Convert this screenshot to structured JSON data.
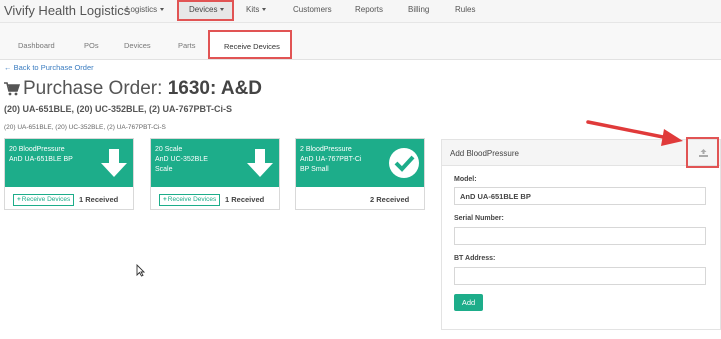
{
  "app": {
    "brand": "Vivify Health Logistics"
  },
  "nav": {
    "items": [
      {
        "label": "Logistics",
        "dropdown": true
      },
      {
        "label": "Devices",
        "dropdown": true,
        "active": true
      },
      {
        "label": "Kits",
        "dropdown": true
      },
      {
        "label": "Customers"
      },
      {
        "label": "Reports"
      },
      {
        "label": "Billing"
      },
      {
        "label": "Rules"
      }
    ]
  },
  "subnav": {
    "tabs": [
      {
        "label": "Dashboard"
      },
      {
        "label": "POs"
      },
      {
        "label": "Devices"
      },
      {
        "label": "Parts"
      },
      {
        "label": "Receive Devices",
        "active": true
      }
    ]
  },
  "back_link": "Back to Purchase Order",
  "po": {
    "title_prefix": "Purchase Order:",
    "number": "1630: A&D",
    "summary": "(20) UA-651BLE, (20) UC-352BLE, (2) UA-767PBT-Ci-S",
    "summary_small": "(20) UA-651BLE, (20) UC-352BLE, (2) UA-767PBT-Ci-S"
  },
  "cards": [
    {
      "line1": "20 BloodPressure",
      "line2": "AnD UA-651BLE BP",
      "line3": "",
      "button": "Receive Devices",
      "count": "1 Received",
      "icon": "download-arrow-icon"
    },
    {
      "line1": "20 Scale",
      "line2": "AnD UC-352BLE",
      "line3": "Scale",
      "button": "Receive Devices",
      "count": "1 Received",
      "icon": "download-arrow-icon"
    },
    {
      "line1": "2 BloodPressure",
      "line2": "AnD UA-767PBT-Ci",
      "line3": "BP Small",
      "button": "",
      "count": "2 Received",
      "icon": "check-circle-icon"
    }
  ],
  "panel": {
    "title": "Add BloodPressure",
    "model_label": "Model:",
    "model_value": "AnD UA-651BLE BP",
    "serial_label": "Serial Number:",
    "serial_value": "",
    "bt_label": "BT Address:",
    "bt_value": "",
    "add_button": "Add"
  },
  "colors": {
    "accent": "#1dad8a",
    "link": "#3a7cc0",
    "highlight": "#e15454"
  }
}
